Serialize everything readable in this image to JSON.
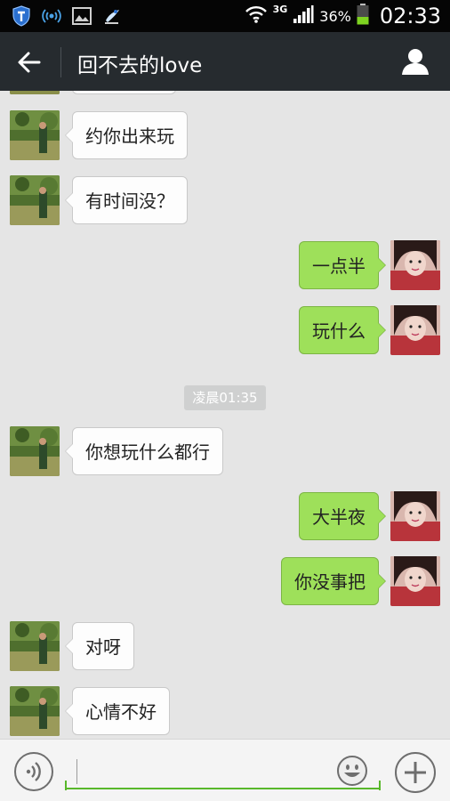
{
  "status_bar": {
    "network": "3G",
    "battery": "36%",
    "time": "02:33"
  },
  "header": {
    "title": "回不去的love"
  },
  "messages": [
    {
      "side": "in",
      "text": "约你出来玩"
    },
    {
      "side": "in",
      "text": "有时间没？"
    },
    {
      "side": "out",
      "text": "一点半"
    },
    {
      "side": "out",
      "text": "玩什么"
    },
    {
      "side": "in",
      "text": "你想玩什么都行"
    },
    {
      "side": "out",
      "text": "大半夜"
    },
    {
      "side": "out",
      "text": "你没事把"
    },
    {
      "side": "in",
      "text": "对呀"
    },
    {
      "side": "in",
      "text": "心情不好"
    }
  ],
  "timestamp": "凌晨01:35",
  "colors": {
    "outgoing_bubble": "#9ee05a",
    "incoming_bubble": "#fdfdfd",
    "title_bar": "#262b2f",
    "input_underline": "#58b82a"
  }
}
